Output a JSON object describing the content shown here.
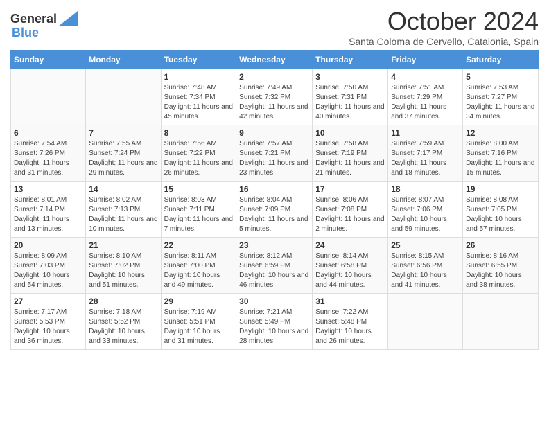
{
  "header": {
    "logo_line1": "General",
    "logo_line2": "Blue",
    "month": "October 2024",
    "subtitle": "Santa Coloma de Cervello, Catalonia, Spain"
  },
  "days_of_week": [
    "Sunday",
    "Monday",
    "Tuesday",
    "Wednesday",
    "Thursday",
    "Friday",
    "Saturday"
  ],
  "weeks": [
    [
      {
        "day": "",
        "info": ""
      },
      {
        "day": "",
        "info": ""
      },
      {
        "day": "1",
        "info": "Sunrise: 7:48 AM\nSunset: 7:34 PM\nDaylight: 11 hours and 45 minutes."
      },
      {
        "day": "2",
        "info": "Sunrise: 7:49 AM\nSunset: 7:32 PM\nDaylight: 11 hours and 42 minutes."
      },
      {
        "day": "3",
        "info": "Sunrise: 7:50 AM\nSunset: 7:31 PM\nDaylight: 11 hours and 40 minutes."
      },
      {
        "day": "4",
        "info": "Sunrise: 7:51 AM\nSunset: 7:29 PM\nDaylight: 11 hours and 37 minutes."
      },
      {
        "day": "5",
        "info": "Sunrise: 7:53 AM\nSunset: 7:27 PM\nDaylight: 11 hours and 34 minutes."
      }
    ],
    [
      {
        "day": "6",
        "info": "Sunrise: 7:54 AM\nSunset: 7:26 PM\nDaylight: 11 hours and 31 minutes."
      },
      {
        "day": "7",
        "info": "Sunrise: 7:55 AM\nSunset: 7:24 PM\nDaylight: 11 hours and 29 minutes."
      },
      {
        "day": "8",
        "info": "Sunrise: 7:56 AM\nSunset: 7:22 PM\nDaylight: 11 hours and 26 minutes."
      },
      {
        "day": "9",
        "info": "Sunrise: 7:57 AM\nSunset: 7:21 PM\nDaylight: 11 hours and 23 minutes."
      },
      {
        "day": "10",
        "info": "Sunrise: 7:58 AM\nSunset: 7:19 PM\nDaylight: 11 hours and 21 minutes."
      },
      {
        "day": "11",
        "info": "Sunrise: 7:59 AM\nSunset: 7:17 PM\nDaylight: 11 hours and 18 minutes."
      },
      {
        "day": "12",
        "info": "Sunrise: 8:00 AM\nSunset: 7:16 PM\nDaylight: 11 hours and 15 minutes."
      }
    ],
    [
      {
        "day": "13",
        "info": "Sunrise: 8:01 AM\nSunset: 7:14 PM\nDaylight: 11 hours and 13 minutes."
      },
      {
        "day": "14",
        "info": "Sunrise: 8:02 AM\nSunset: 7:13 PM\nDaylight: 11 hours and 10 minutes."
      },
      {
        "day": "15",
        "info": "Sunrise: 8:03 AM\nSunset: 7:11 PM\nDaylight: 11 hours and 7 minutes."
      },
      {
        "day": "16",
        "info": "Sunrise: 8:04 AM\nSunset: 7:09 PM\nDaylight: 11 hours and 5 minutes."
      },
      {
        "day": "17",
        "info": "Sunrise: 8:06 AM\nSunset: 7:08 PM\nDaylight: 11 hours and 2 minutes."
      },
      {
        "day": "18",
        "info": "Sunrise: 8:07 AM\nSunset: 7:06 PM\nDaylight: 10 hours and 59 minutes."
      },
      {
        "day": "19",
        "info": "Sunrise: 8:08 AM\nSunset: 7:05 PM\nDaylight: 10 hours and 57 minutes."
      }
    ],
    [
      {
        "day": "20",
        "info": "Sunrise: 8:09 AM\nSunset: 7:03 PM\nDaylight: 10 hours and 54 minutes."
      },
      {
        "day": "21",
        "info": "Sunrise: 8:10 AM\nSunset: 7:02 PM\nDaylight: 10 hours and 51 minutes."
      },
      {
        "day": "22",
        "info": "Sunrise: 8:11 AM\nSunset: 7:00 PM\nDaylight: 10 hours and 49 minutes."
      },
      {
        "day": "23",
        "info": "Sunrise: 8:12 AM\nSunset: 6:59 PM\nDaylight: 10 hours and 46 minutes."
      },
      {
        "day": "24",
        "info": "Sunrise: 8:14 AM\nSunset: 6:58 PM\nDaylight: 10 hours and 44 minutes."
      },
      {
        "day": "25",
        "info": "Sunrise: 8:15 AM\nSunset: 6:56 PM\nDaylight: 10 hours and 41 minutes."
      },
      {
        "day": "26",
        "info": "Sunrise: 8:16 AM\nSunset: 6:55 PM\nDaylight: 10 hours and 38 minutes."
      }
    ],
    [
      {
        "day": "27",
        "info": "Sunrise: 7:17 AM\nSunset: 5:53 PM\nDaylight: 10 hours and 36 minutes."
      },
      {
        "day": "28",
        "info": "Sunrise: 7:18 AM\nSunset: 5:52 PM\nDaylight: 10 hours and 33 minutes."
      },
      {
        "day": "29",
        "info": "Sunrise: 7:19 AM\nSunset: 5:51 PM\nDaylight: 10 hours and 31 minutes."
      },
      {
        "day": "30",
        "info": "Sunrise: 7:21 AM\nSunset: 5:49 PM\nDaylight: 10 hours and 28 minutes."
      },
      {
        "day": "31",
        "info": "Sunrise: 7:22 AM\nSunset: 5:48 PM\nDaylight: 10 hours and 26 minutes."
      },
      {
        "day": "",
        "info": ""
      },
      {
        "day": "",
        "info": ""
      }
    ]
  ]
}
